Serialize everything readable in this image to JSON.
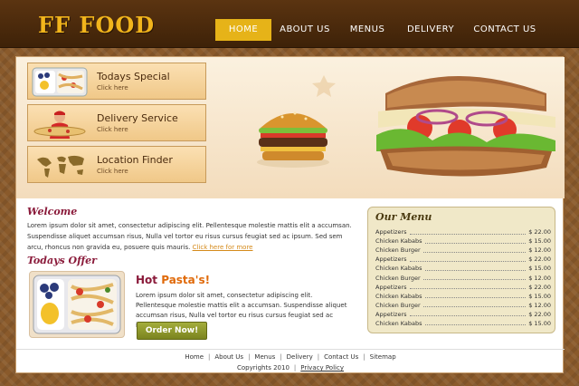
{
  "brand": {
    "logo_text": "FF FOOD"
  },
  "nav": {
    "items": [
      {
        "label": "HOME",
        "active": true
      },
      {
        "label": "ABOUT US",
        "active": false
      },
      {
        "label": "MENUS",
        "active": false
      },
      {
        "label": "DELIVERY",
        "active": false
      },
      {
        "label": "CONTACT US",
        "active": false
      }
    ]
  },
  "sidebar": {
    "items": [
      {
        "title": "Todays Special",
        "sub": "Click here",
        "icon": "pasta-tray-icon"
      },
      {
        "title": "Delivery Service",
        "sub": "Click here",
        "icon": "delivery-person-icon"
      },
      {
        "title": "Location Finder",
        "sub": "Click here",
        "icon": "world-map-icon"
      }
    ]
  },
  "welcome": {
    "title": "Welcome",
    "text": "Lorem ipsum dolor sit amet, consectetur adipiscing elit. Pellentesque molestie mattis elit a accumsan. Suspendisse aliquet accumsan risus, Nulla vel tortor eu risus cursus feugiat sed ac ipsum. Sed sem arcu, rhoncus non gravida eu, posuere quis mauris.",
    "link": "Click here for more"
  },
  "offer": {
    "title": "Todays Offer",
    "hot_word": "Hot",
    "dish": "Pasta's!",
    "text": "Lorem ipsum dolor sit amet, consectetur adipiscing elit. Pellentesque molestie mattis elit a accumsan. Suspendisse aliquet accumsan risus, Nulla vel tortor eu risus cursus feugiat sed ac ipsum.",
    "button": "Order Now!"
  },
  "menu": {
    "title": "Our Menu",
    "items": [
      {
        "name": "Appetizers",
        "price": "$ 22.00"
      },
      {
        "name": "Chicken Kababs",
        "price": "$ 15.00"
      },
      {
        "name": "Chicken Burger",
        "price": "$ 12.00"
      },
      {
        "name": "Appetizers",
        "price": "$ 22.00"
      },
      {
        "name": "Chicken Kababs",
        "price": "$ 15.00"
      },
      {
        "name": "Chicken Burger",
        "price": "$ 12.00"
      },
      {
        "name": "Appetizers",
        "price": "$ 22.00"
      },
      {
        "name": "Chicken Kababs",
        "price": "$ 15.00"
      },
      {
        "name": "Chicken Burger",
        "price": "$ 12.00"
      },
      {
        "name": "Appetizers",
        "price": "$ 22.00"
      },
      {
        "name": "Chicken Kababs",
        "price": "$ 15.00"
      }
    ]
  },
  "footer": {
    "links": [
      "Home",
      "About Us",
      "Menus",
      "Delivery",
      "Contact Us",
      "Sitemap"
    ],
    "separator": "|",
    "copyright": "Copyrights 2010",
    "privacy": "Privacy Policy"
  },
  "colors": {
    "brand_gold": "#f2b51c",
    "header_brown": "#3e2208",
    "nav_active": "#e6b318",
    "heading_maroon": "#8a1a3a",
    "hot_orange": "#e06a0a",
    "order_green": "#7b841f"
  }
}
